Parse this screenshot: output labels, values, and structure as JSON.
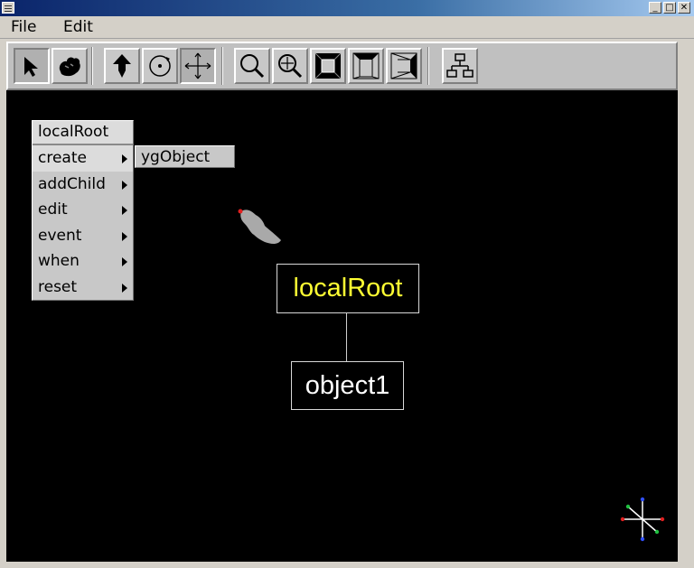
{
  "menubar": {
    "file": "File",
    "edit": "Edit"
  },
  "window": {
    "min": "_",
    "max": "□",
    "close": "✕"
  },
  "toolbar": {
    "buttons": [
      "select-arrow-icon",
      "navigate-hand-icon",
      "move-up-arrow-icon",
      "rotate-icon",
      "translate-cross-icon",
      "zoom-icon",
      "zoom-center-icon",
      "view-front-icon",
      "view-top-icon",
      "view-side-icon",
      "hierarchy-icon"
    ],
    "pressed": "translate-cross-icon"
  },
  "context_menu": {
    "title": "localRoot",
    "items": [
      {
        "label": "create",
        "has_submenu": true
      },
      {
        "label": "addChild",
        "has_submenu": true
      },
      {
        "label": "edit",
        "has_submenu": true
      },
      {
        "label": "event",
        "has_submenu": true
      },
      {
        "label": "when",
        "has_submenu": true
      },
      {
        "label": "reset",
        "has_submenu": true
      }
    ],
    "active_index": 0
  },
  "submenu": {
    "items": [
      {
        "label": "ygObject"
      }
    ]
  },
  "scene_graph": {
    "root": {
      "label": "localRoot",
      "color": "#ffff33"
    },
    "child": {
      "label": "object1",
      "color": "#ffffff"
    }
  },
  "colors": {
    "canvas": "#000000",
    "toolbar": "#c0c0c0",
    "root_text": "#ffff33"
  }
}
